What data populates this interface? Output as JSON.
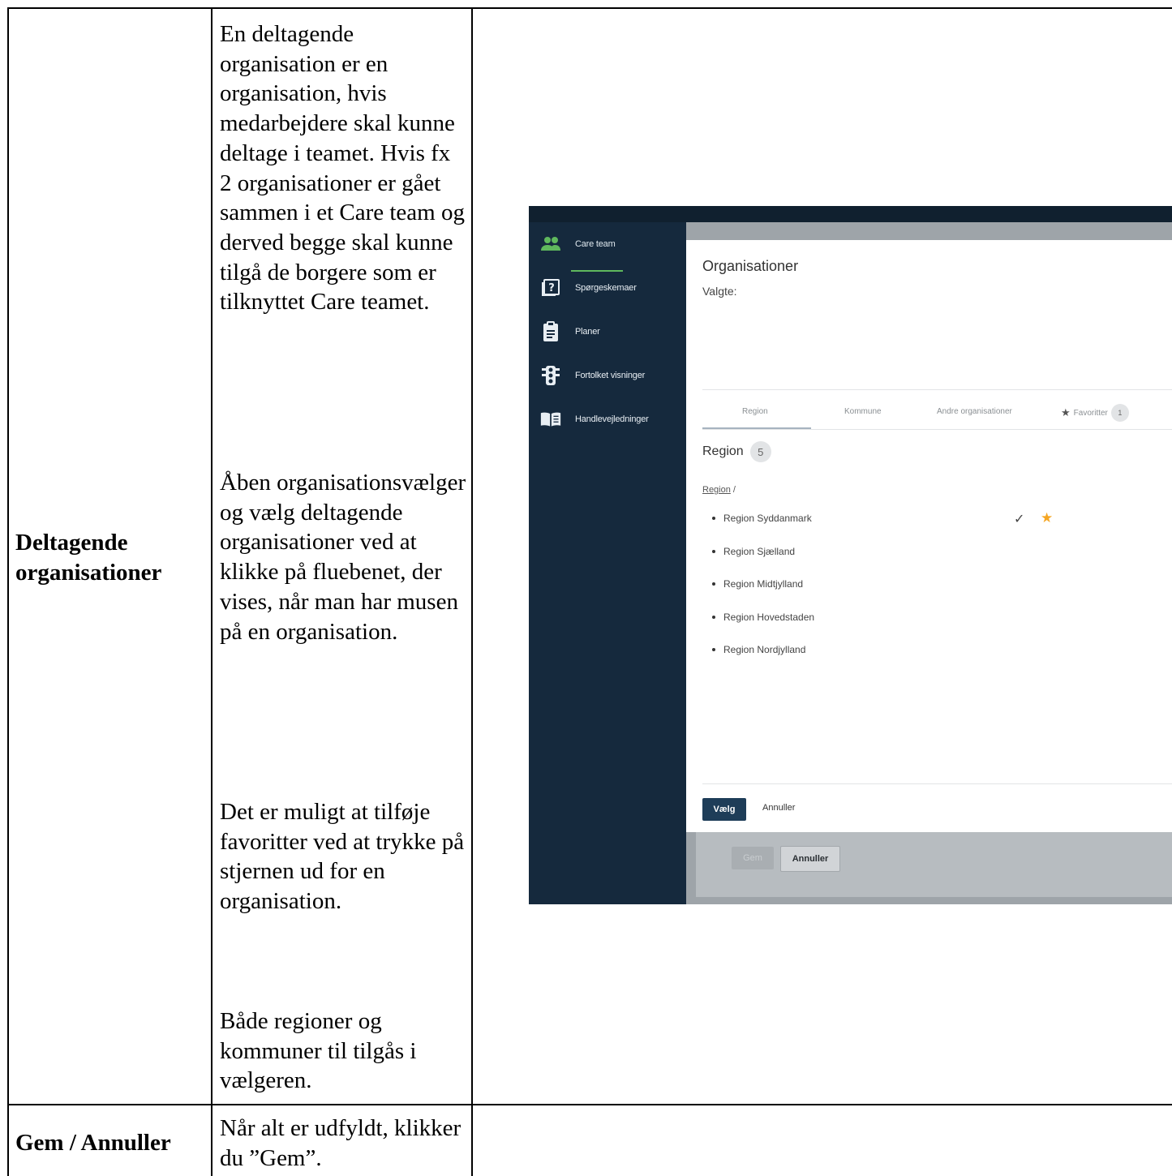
{
  "table": {
    "row1": {
      "label": "Deltagende organisationer",
      "paragraphs": [
        "En deltagende organisation er en organisation, hvis medarbejdere skal kunne deltage i teamet. Hvis fx 2 organisationer er gået sammen i et Care team og derved begge skal kunne tilgå de borgere som er tilknyttet Care teamet.",
        "Åben organisationsvælger og vælg deltagende organisationer ved at klikke på fluebenet, der vises, når man har musen på en organisation.",
        "Det er muligt at tilføje favoritter ved at trykke på stjernen ud for en organisation.",
        "Både regioner og kommuner til tilgås i vælgeren."
      ]
    },
    "row2": {
      "label": "Gem / Annuller",
      "text": "Når alt er udfyldt, klikker du ”Gem”."
    }
  },
  "screenshot": {
    "sidebar": {
      "items": [
        {
          "label": "Care team",
          "icon": "people-icon"
        },
        {
          "label": "Spørgeskemaer",
          "icon": "question-icon"
        },
        {
          "label": "Planer",
          "icon": "clipboard-icon"
        },
        {
          "label": "Fortolket visninger",
          "icon": "traffic-light-icon"
        },
        {
          "label": "Handlevejledninger",
          "icon": "book-icon"
        }
      ]
    },
    "dialog": {
      "title": "Organisationer",
      "selected_label": "Valgte:",
      "tabs": [
        "Region",
        "Kommune",
        "Andre organisationer",
        "Favoritter"
      ],
      "favorites_count": "1",
      "section_title": "Region",
      "section_count": "5",
      "breadcrumb_link": "Region",
      "breadcrumb_sep": "/",
      "regions": [
        "Region Syddanmark",
        "Region Sjælland",
        "Region Midtjylland",
        "Region Hovedstaden",
        "Region Nordjylland"
      ],
      "choose_label": "Vælg",
      "cancel_label": "Annuller"
    },
    "background_form": {
      "save_label": "Gem",
      "cancel_label": "Annuller"
    },
    "colors": {
      "sidebar": "#15293d",
      "primary_button": "#1e3d58",
      "active_green": "#5fb85d",
      "star": "#f5a623"
    }
  }
}
